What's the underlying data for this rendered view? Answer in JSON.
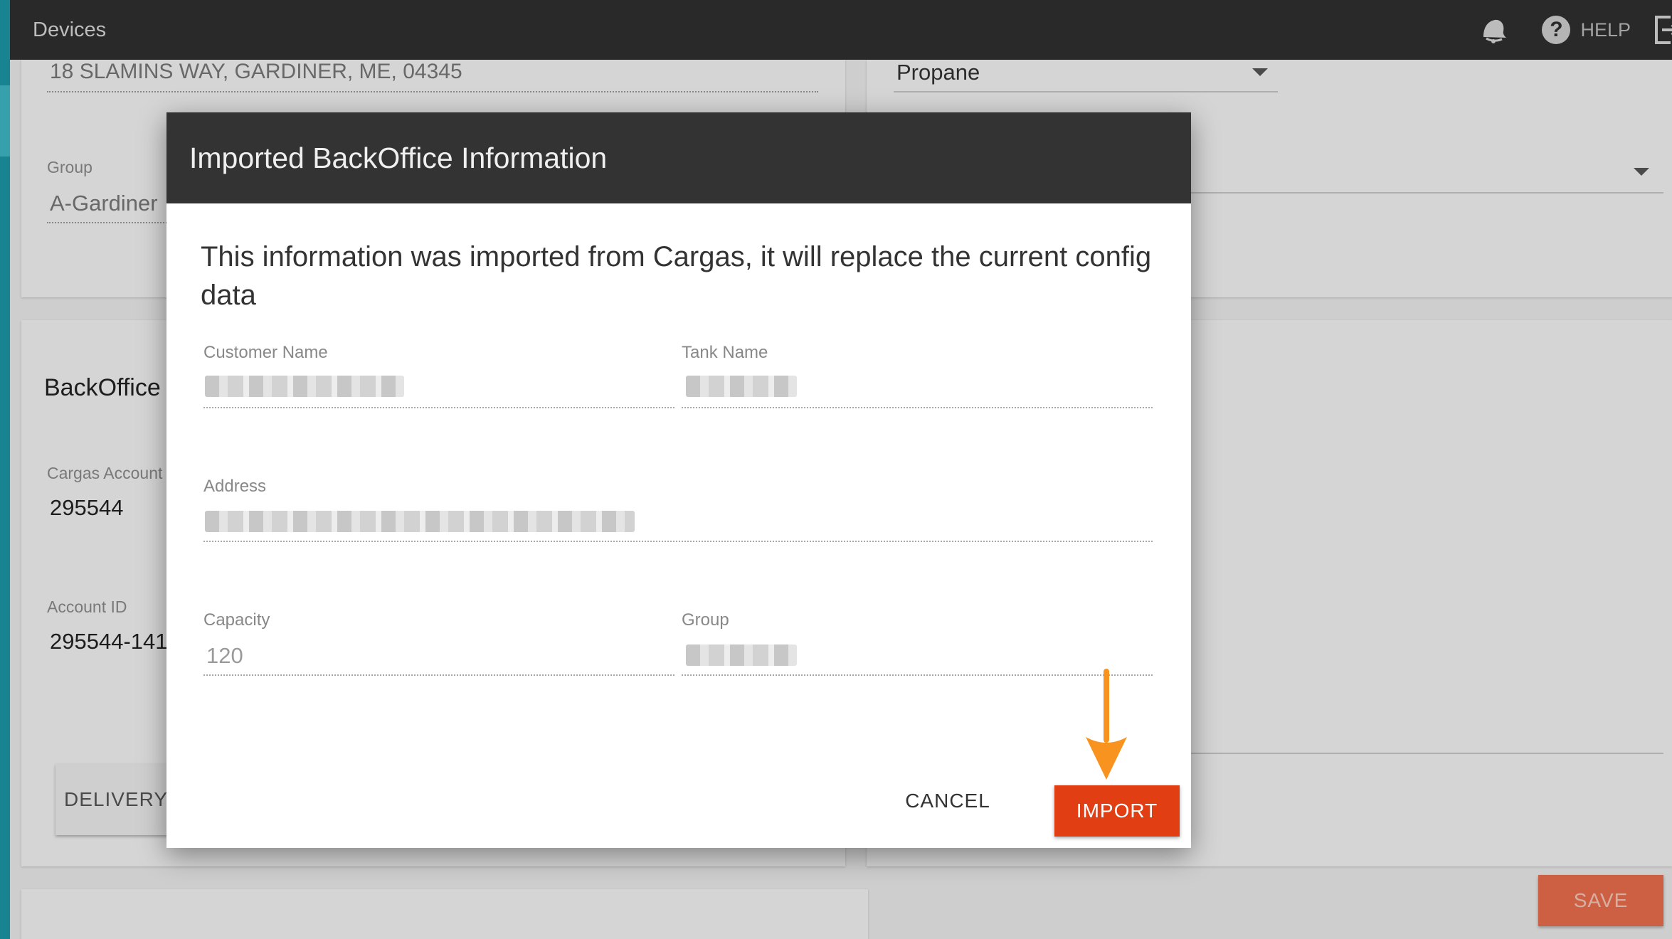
{
  "topbar": {
    "title": "Devices",
    "help_label": "HELP",
    "icons": [
      "bell-icon",
      "help-icon",
      "exit-icon"
    ]
  },
  "background_form": {
    "address_value": "18 SLAMINS WAY, GARDINER, ME, 04345",
    "product_value": "Propane",
    "group_label": "Group",
    "group_value": "A-Gardiner",
    "section_title": "BackOffice S",
    "cargas_account_label": "Cargas Account",
    "cargas_account_value": "295544",
    "account_id_label": "Account ID",
    "account_id_value": "295544-141",
    "delivery_button": "DELIVERY",
    "save_button": "SAVE"
  },
  "dialog": {
    "title": "Imported BackOffice Information",
    "message": "This information was imported from Cargas, it will replace the current config data",
    "fields": {
      "customer_name_label": "Customer Name",
      "tank_name_label": "Tank Name",
      "address_label": "Address",
      "capacity_label": "Capacity",
      "capacity_value": "120",
      "group_label": "Group"
    },
    "cancel_button": "CANCEL",
    "import_button": "IMPORT"
  },
  "colors": {
    "topbar": "#2f2f2f",
    "accent_import": "#e13e14",
    "save_button": "#ea6e4c",
    "annotation_arrow": "#f7931e",
    "side_strip": "#1d97a6"
  }
}
